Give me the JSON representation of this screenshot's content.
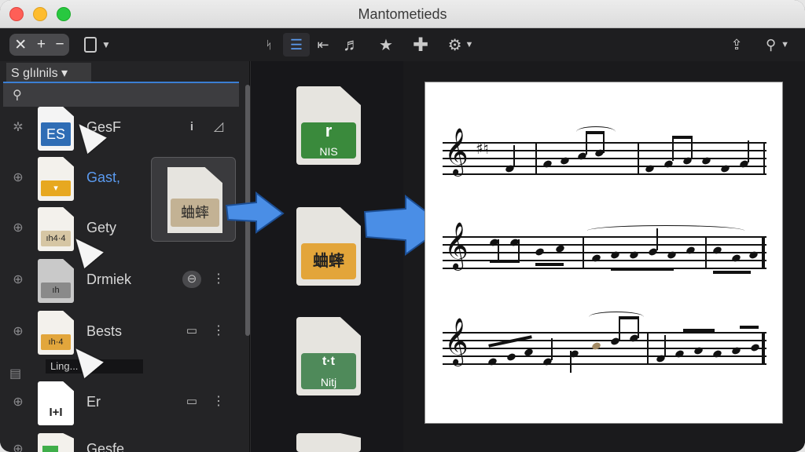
{
  "window": {
    "title": "Mantometieds"
  },
  "toolbar": {
    "left_segment": [
      "✕",
      "+",
      "−"
    ],
    "view_icon": "window-icon",
    "right_tools": [
      "list-icon",
      "outdent-icon",
      "note-icon",
      "star-icon",
      "plus-icon",
      "gear-icon"
    ],
    "far_right": [
      "share-icon",
      "search-icon"
    ]
  },
  "sidebar": {
    "header": "S glılnils ▾",
    "items": [
      {
        "name": "GesF",
        "thumb_label": "ES",
        "thumb_color": "#2f6db5",
        "action": "i",
        "more": "⌖"
      },
      {
        "name": "Gast,",
        "thumb_label": "▾",
        "thumb_color": "#e7a820"
      },
      {
        "name": "Gety",
        "thumb_label": "ıh4·4",
        "thumb_color": "#d6c6a4"
      },
      {
        "name": "Drmiek",
        "thumb_label": "ıh",
        "thumb_color": "#8a8a8a",
        "action": "⊖",
        "more": "⋮"
      },
      {
        "name": "Bests",
        "thumb_label": "ıh·4",
        "thumb_color": "#e2a63c",
        "action": "▭",
        "more": "⋮"
      },
      {
        "name": "Er",
        "thumb_label": "I+I",
        "thumb_color": "#ffffff",
        "action": "▭",
        "more": "⋮"
      },
      {
        "name": "Gesfe",
        "thumb_label": "",
        "thumb_color": "#3fae4a"
      }
    ],
    "tooltip": "Ling..."
  },
  "drag_preview": {
    "label": "蛐蟀"
  },
  "middle_files": [
    {
      "badge": "NIS",
      "badge_top": "r",
      "color": "#3a8a3c"
    },
    {
      "badge": "蛐蟀",
      "color": "#e3a53a"
    },
    {
      "badge": "Nitj",
      "badge_top": "t·t",
      "color": "#4f8a5a"
    }
  ],
  "colors": {
    "accent": "#3b7fd4",
    "arrow": "#3b7fd4"
  }
}
